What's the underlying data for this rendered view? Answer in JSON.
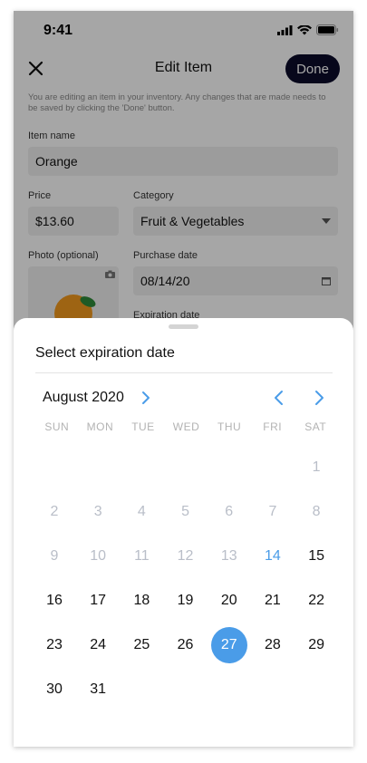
{
  "status": {
    "time": "9:41"
  },
  "header": {
    "title": "Edit Item",
    "done_label": "Done"
  },
  "helper_text": "You are editing an item in your inventory. Any changes that are made needs to be saved by clicking the 'Done' button.",
  "form": {
    "item_name_label": "Item name",
    "item_name_value": "Orange",
    "price_label": "Price",
    "price_value": "$13.60",
    "category_label": "Category",
    "category_value": "Fruit & Vegetables",
    "photo_label": "Photo (optional)",
    "purchase_label": "Purchase date",
    "purchase_value": "08/14/20",
    "expiration_label": "Expiration date"
  },
  "sheet": {
    "title": "Select expiration date",
    "month": "August 2020",
    "weekdays": [
      "SUN",
      "MON",
      "TUE",
      "WED",
      "THU",
      "FRI",
      "SAT"
    ],
    "leading_blanks": 6,
    "days": [
      {
        "d": "1",
        "s": "muted"
      },
      {
        "d": "2",
        "s": "muted"
      },
      {
        "d": "3",
        "s": "muted"
      },
      {
        "d": "4",
        "s": "muted"
      },
      {
        "d": "5",
        "s": "muted"
      },
      {
        "d": "6",
        "s": "muted"
      },
      {
        "d": "7",
        "s": "muted"
      },
      {
        "d": "8",
        "s": "muted"
      },
      {
        "d": "9",
        "s": "muted"
      },
      {
        "d": "10",
        "s": "muted"
      },
      {
        "d": "11",
        "s": "muted"
      },
      {
        "d": "12",
        "s": "muted"
      },
      {
        "d": "13",
        "s": "muted"
      },
      {
        "d": "14",
        "s": "today"
      },
      {
        "d": "15",
        "s": "normal"
      },
      {
        "d": "16",
        "s": "normal"
      },
      {
        "d": "17",
        "s": "normal"
      },
      {
        "d": "18",
        "s": "normal"
      },
      {
        "d": "19",
        "s": "normal"
      },
      {
        "d": "20",
        "s": "normal"
      },
      {
        "d": "21",
        "s": "normal"
      },
      {
        "d": "22",
        "s": "normal"
      },
      {
        "d": "23",
        "s": "normal"
      },
      {
        "d": "24",
        "s": "normal"
      },
      {
        "d": "25",
        "s": "normal"
      },
      {
        "d": "26",
        "s": "normal"
      },
      {
        "d": "27",
        "s": "selected"
      },
      {
        "d": "28",
        "s": "normal"
      },
      {
        "d": "29",
        "s": "normal"
      },
      {
        "d": "30",
        "s": "normal"
      },
      {
        "d": "31",
        "s": "normal"
      }
    ]
  },
  "colors": {
    "accent": "#4a9ce8",
    "done_bg": "#0b0b2a"
  }
}
